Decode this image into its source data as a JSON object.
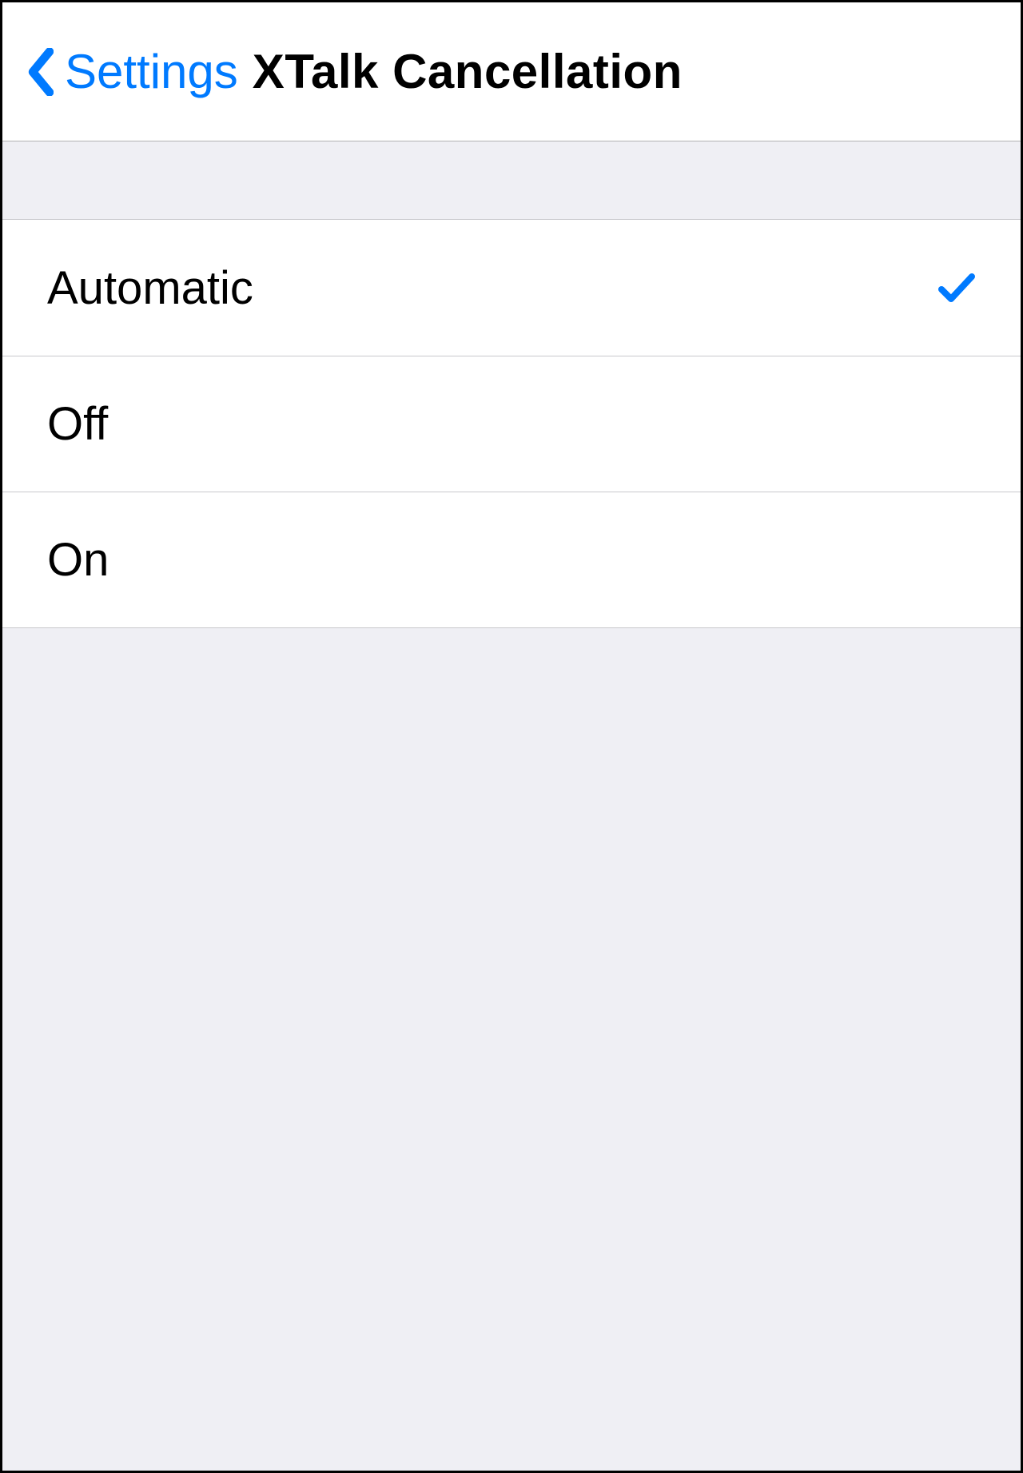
{
  "colors": {
    "accent": "#007aff",
    "separator": "#c8c8cc",
    "background": "#efeff4"
  },
  "navbar": {
    "back_label": "Settings",
    "title": "XTalk Cancellation"
  },
  "options": [
    {
      "label": "Automatic",
      "selected": true
    },
    {
      "label": "Off",
      "selected": false
    },
    {
      "label": "On",
      "selected": false
    }
  ]
}
